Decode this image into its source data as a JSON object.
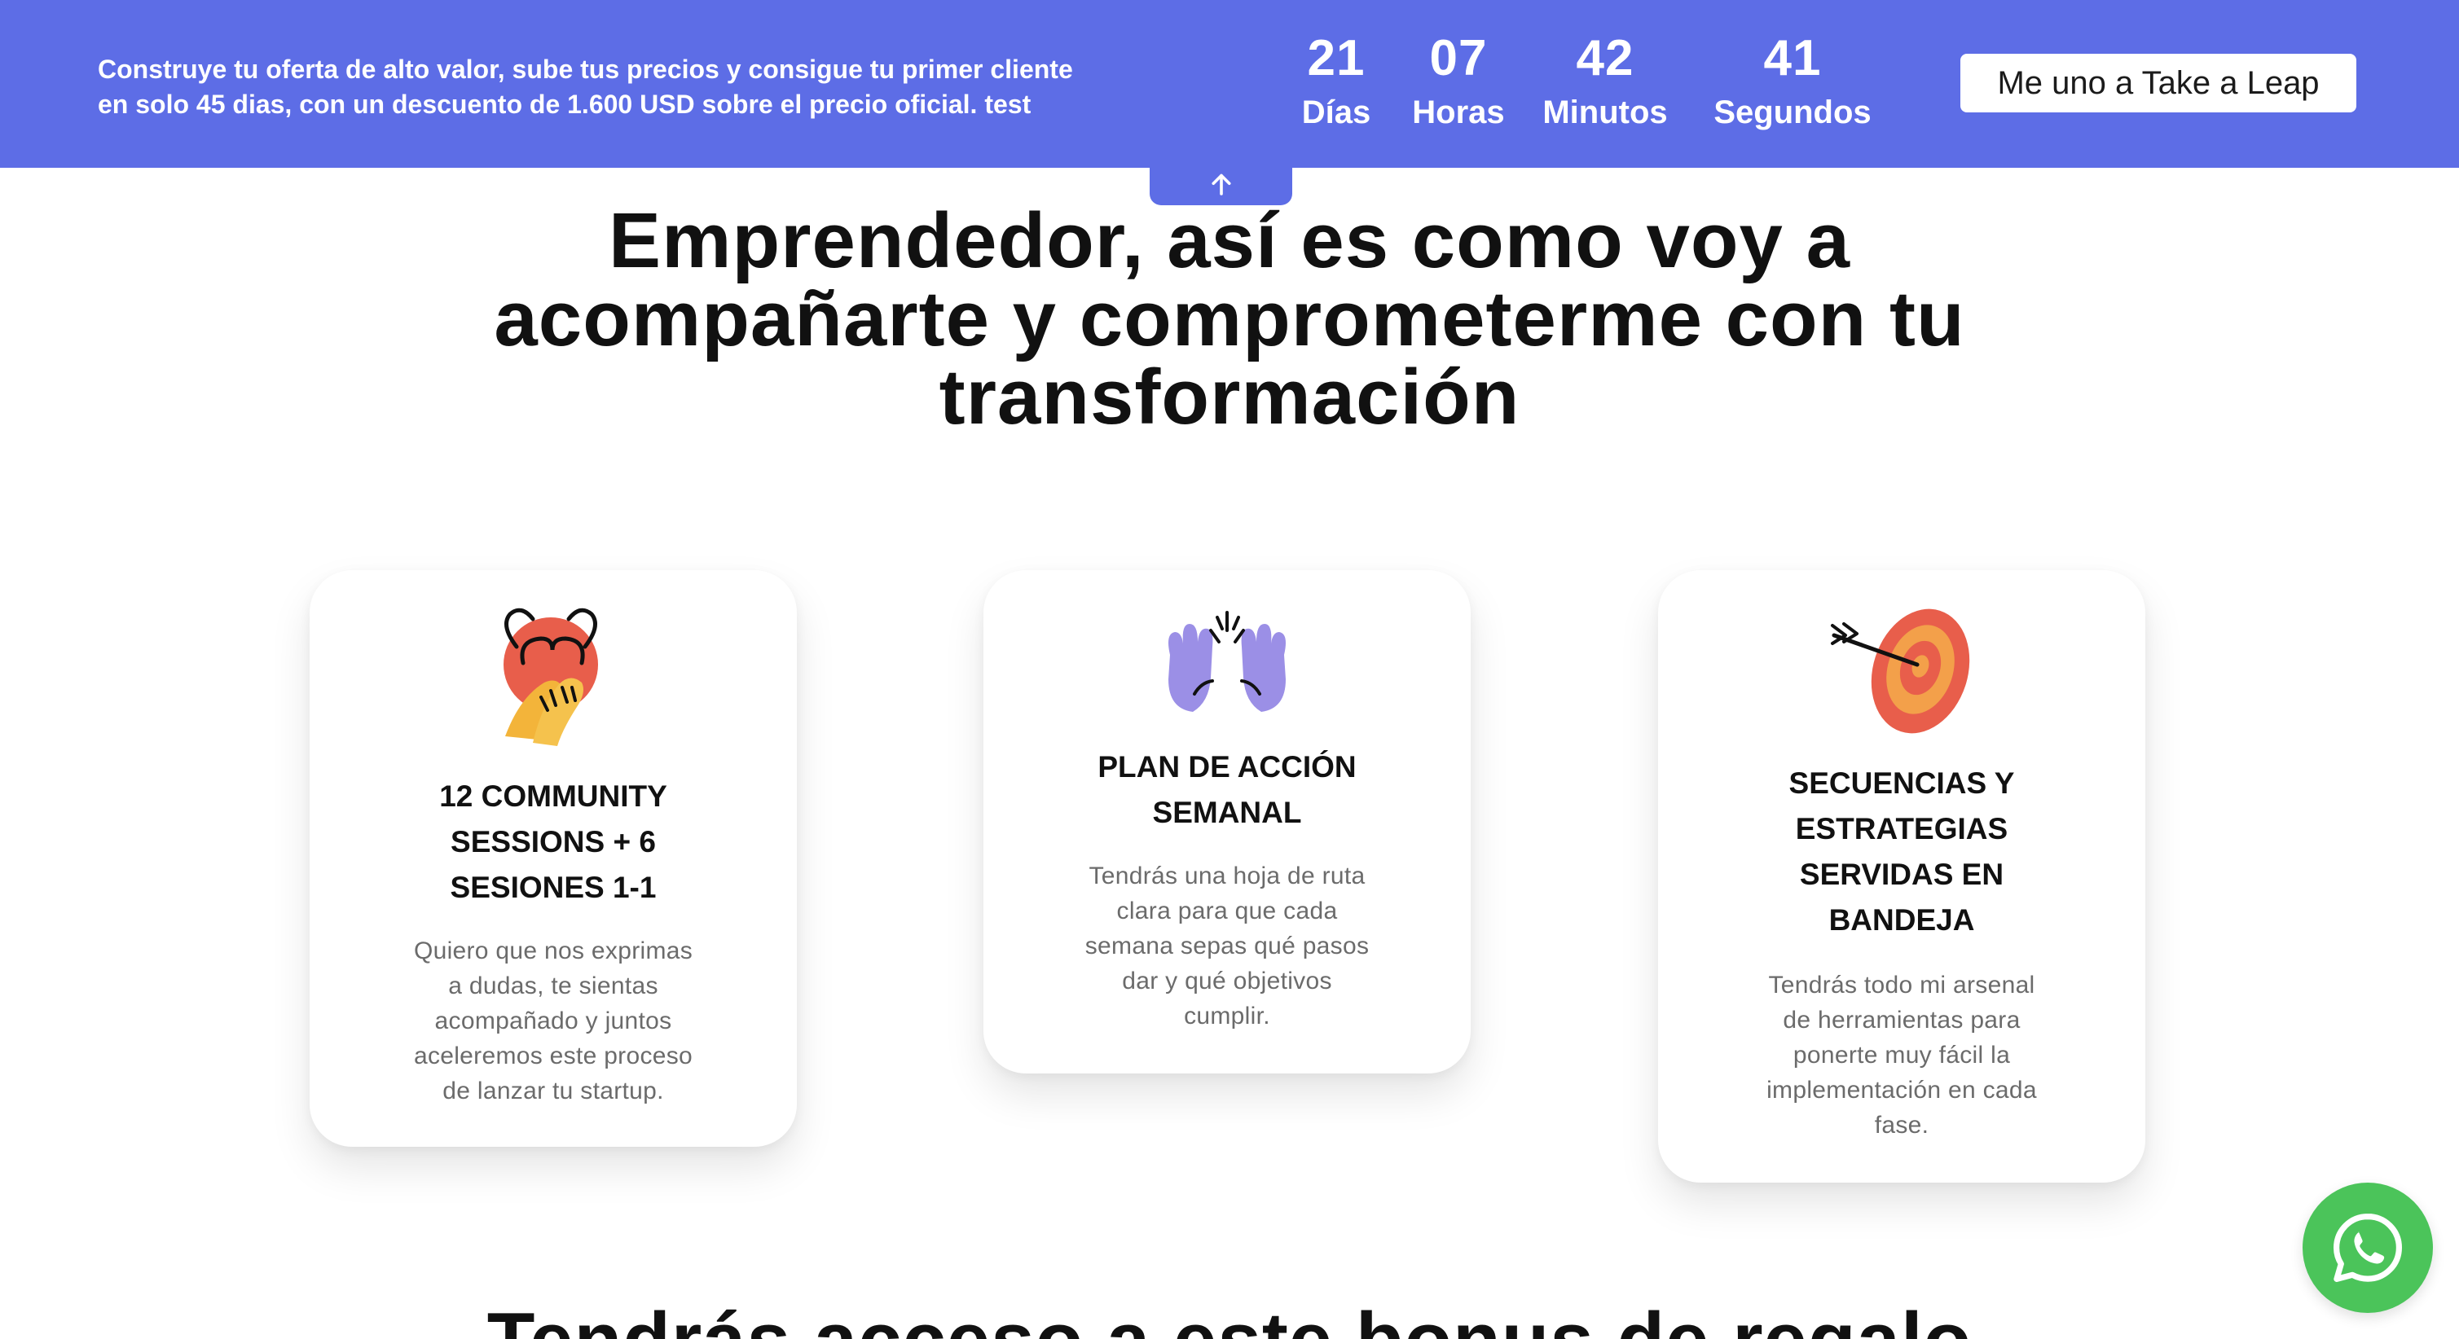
{
  "promo": {
    "text_line1": "Construye tu oferta de alto valor, sube tus precios y consigue tu primer cliente",
    "text_line2": "en solo 45 dias, con un descuento de 1.600 USD sobre el precio oficial. test",
    "countdown": {
      "days_value": "21",
      "days_label": "Días",
      "hours_value": "07",
      "hours_label": "Horas",
      "minutes_value": "42",
      "minutes_label": "Minutos",
      "seconds_value": "41",
      "seconds_label": "Segundos"
    },
    "cta_label": "Me uno a Take a Leap",
    "bar_color": "#5d6de6"
  },
  "heading": {
    "line1": "Emprendedor, así es como voy a",
    "line2": "acompañarte y comprometerme con tu",
    "line3": "transformación"
  },
  "cards": [
    {
      "icon": "hug-heart-icon",
      "title_lines": [
        "12 COMMUNITY",
        "SESSIONS + 6",
        "SESIONES 1-1"
      ],
      "text_lines": [
        "Quiero que nos exprimas",
        "a dudas, te sientas",
        "acompañado y juntos",
        "aceleremos este proceso",
        "de lanzar tu startup."
      ]
    },
    {
      "icon": "raised-hands-icon",
      "title_lines": [
        "PLAN DE ACCIÓN",
        "SEMANAL"
      ],
      "text_lines": [
        "Tendrás una hoja de ruta",
        "clara para que cada",
        "semana sepas qué pasos",
        "dar y qué objetivos",
        "cumplir."
      ]
    },
    {
      "icon": "target-arrow-icon",
      "title_lines": [
        "SECUENCIAS Y",
        "ESTRATEGIAS",
        "SERVIDAS EN",
        "BANDEJA"
      ],
      "text_lines": [
        "Tendrás todo mi arsenal",
        "de herramientas para",
        "ponerte muy fácil la",
        "implementación en cada",
        "fase."
      ]
    }
  ],
  "next_section": {
    "title_partial": "Tendrás acceso a este bonus de regalo"
  },
  "whatsapp": {
    "icon": "whatsapp-icon",
    "color": "#4bc45a"
  }
}
